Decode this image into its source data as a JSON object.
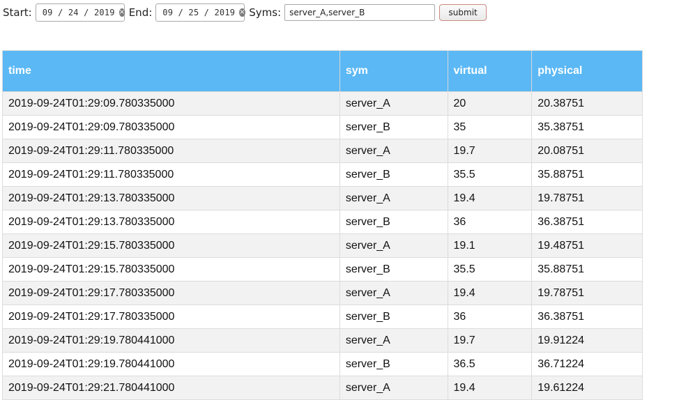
{
  "toolbar": {
    "start_label": "Start:",
    "start_value": "09 / 24 / 2019",
    "end_label": "End:",
    "end_value": "09 / 25 / 2019",
    "clear_glyph": "×",
    "syms_label": "Syms:",
    "syms_value": "server_A,server_B",
    "submit_label": "submit"
  },
  "table": {
    "columns": [
      "time",
      "sym",
      "virtual",
      "physical"
    ],
    "rows": [
      [
        "2019-09-24T01:29:09.780335000",
        "server_A",
        "20",
        "20.38751"
      ],
      [
        "2019-09-24T01:29:09.780335000",
        "server_B",
        "35",
        "35.38751"
      ],
      [
        "2019-09-24T01:29:11.780335000",
        "server_A",
        "19.7",
        "20.08751"
      ],
      [
        "2019-09-24T01:29:11.780335000",
        "server_B",
        "35.5",
        "35.88751"
      ],
      [
        "2019-09-24T01:29:13.780335000",
        "server_A",
        "19.4",
        "19.78751"
      ],
      [
        "2019-09-24T01:29:13.780335000",
        "server_B",
        "36",
        "36.38751"
      ],
      [
        "2019-09-24T01:29:15.780335000",
        "server_A",
        "19.1",
        "19.48751"
      ],
      [
        "2019-09-24T01:29:15.780335000",
        "server_B",
        "35.5",
        "35.88751"
      ],
      [
        "2019-09-24T01:29:17.780335000",
        "server_A",
        "19.4",
        "19.78751"
      ],
      [
        "2019-09-24T01:29:17.780335000",
        "server_B",
        "36",
        "36.38751"
      ],
      [
        "2019-09-24T01:29:19.780441000",
        "server_A",
        "19.7",
        "19.91224"
      ],
      [
        "2019-09-24T01:29:19.780441000",
        "server_B",
        "36.5",
        "36.71224"
      ],
      [
        "2019-09-24T01:29:21.780441000",
        "server_A",
        "19.4",
        "19.61224"
      ]
    ]
  }
}
